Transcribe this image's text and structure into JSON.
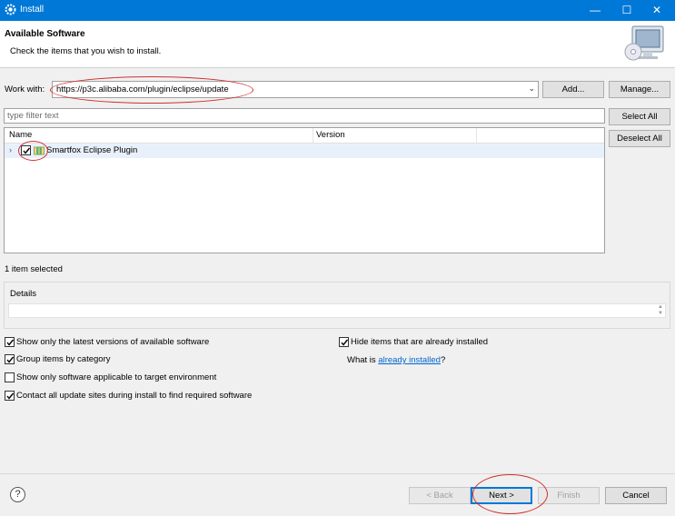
{
  "window": {
    "title": "Install",
    "icon": "eclipse-gear-icon",
    "controls": {
      "minimize": "—",
      "maximize": "☐",
      "close": "✕"
    }
  },
  "header": {
    "title": "Available Software",
    "subtitle": "Check the items that you wish to install.",
    "icon": "computer-cd-icon"
  },
  "work_with": {
    "label": "Work with:",
    "value": "https://p3c.alibaba.com/plugin/eclipse/update",
    "add_label": "Add...",
    "manage_label": "Manage..."
  },
  "filter": {
    "placeholder": "type filter text"
  },
  "side_buttons": {
    "select_all": "Select All",
    "deselect_all": "Deselect All"
  },
  "table": {
    "columns": [
      "Name",
      "Version"
    ],
    "rows": [
      {
        "expander": "›",
        "checked": true,
        "name": "Smartfox Eclipse Plugin",
        "version": ""
      }
    ]
  },
  "status": {
    "selected_count": "1 item selected"
  },
  "details": {
    "label": "Details",
    "text": ""
  },
  "options": {
    "latest_versions": {
      "label": "Show only the latest versions of available software",
      "checked": true
    },
    "group_by_category": {
      "label": "Group items by category",
      "checked": true
    },
    "applicable_target": {
      "label": "Show only software applicable to target environment",
      "checked": false
    },
    "contact_all_sites": {
      "label": "Contact all update sites during install to find required software",
      "checked": true
    },
    "hide_installed": {
      "label": "Hide items that are already installed",
      "checked": true
    }
  },
  "what_is": {
    "prefix": "What is ",
    "link": "already installed",
    "suffix": "?"
  },
  "footer": {
    "back_label": "< Back",
    "next_label": "Next >",
    "finish_label": "Finish",
    "cancel_label": "Cancel",
    "help_symbol": "?"
  },
  "colors": {
    "titlebar": "#0078d7",
    "annotation_red": "#d32f2f",
    "selected_row": "#e8f1fb",
    "link": "#0066cc"
  }
}
